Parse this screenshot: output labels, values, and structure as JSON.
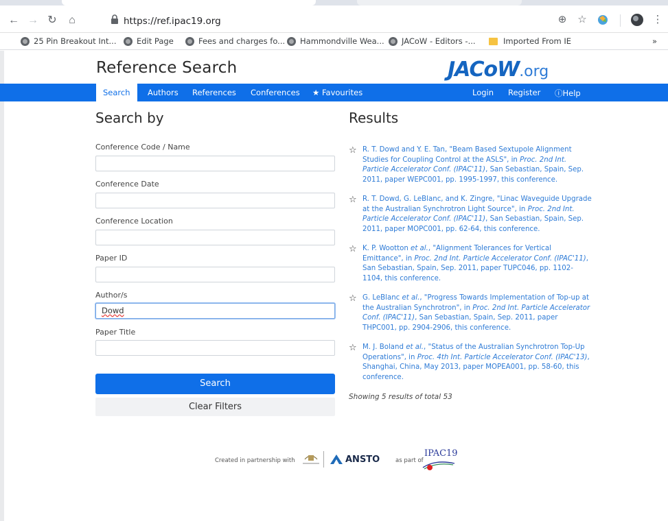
{
  "browser": {
    "url": "https://ref.ipac19.org",
    "bookmarks": [
      {
        "label": "25 Pin Breakout Int...",
        "icon": "globe-icon"
      },
      {
        "label": "Edit Page",
        "icon": "globe-icon"
      },
      {
        "label": "Fees and charges fo...",
        "icon": "globe-icon"
      },
      {
        "label": "Hammondville Wea...",
        "icon": "globe-icon"
      },
      {
        "label": "JACoW - Editors -...",
        "icon": "globe-icon"
      },
      {
        "label": "Imported From IE",
        "icon": "folder-icon"
      }
    ],
    "overflow": "»"
  },
  "header": {
    "title": "Reference Search",
    "logo_main": "JACoW",
    "logo_suffix": ".org"
  },
  "nav": {
    "items": [
      "Search",
      "Authors",
      "References",
      "Conferences",
      "Favourites"
    ],
    "right_items": [
      "Login",
      "Register",
      "Help"
    ],
    "active": "Search",
    "accent_color": "#0f6fe8"
  },
  "search_form": {
    "title": "Search by",
    "fields": [
      {
        "label": "Conference Code / Name",
        "value": ""
      },
      {
        "label": "Conference Date",
        "value": ""
      },
      {
        "label": "Conference Location",
        "value": ""
      },
      {
        "label": "Paper ID",
        "value": ""
      },
      {
        "label": "Author/s",
        "value": "Dowd"
      },
      {
        "label": "Paper Title",
        "value": ""
      }
    ],
    "search_label": "Search",
    "clear_label": "Clear Filters"
  },
  "results": {
    "title": "Results",
    "items": [
      {
        "before": "R. T. Dowd and Y. E. Tan, \"Beam Based Sextupole Alignment Studies for Coupling Control at the ASLS\", in ",
        "italic": "Proc. 2nd Int. Particle Accelerator Conf. (IPAC'11)",
        "after": ", San Sebastian, Spain, Sep. 2011, paper WEPC001, pp. 1995-1997, this conference."
      },
      {
        "before": "R. T. Dowd, G. LeBlanc, and K. Zingre, \"Linac Waveguide Upgrade at the Australian Synchrotron Light Source\", in ",
        "italic": "Proc. 2nd Int. Particle Accelerator Conf. (IPAC'11)",
        "after": ", San Sebastian, Spain, Sep. 2011, paper MOPC001, pp. 62-64, this conference."
      },
      {
        "before": "K. P. Wootton ",
        "italic0": "et al.",
        "middle": ", \"Alignment Tolerances for Vertical Emittance\", in ",
        "italic": "Proc. 2nd Int. Particle Accelerator Conf. (IPAC'11)",
        "after": ", San Sebastian, Spain, Sep. 2011, paper TUPC046, pp. 1102-1104, this conference."
      },
      {
        "before": "G. LeBlanc ",
        "italic0": "et al.",
        "middle": ", \"Progress Towards Implementation of Top-up at the Australian Synchrotron\", in ",
        "italic": "Proc. 2nd Int. Particle Accelerator Conf. (IPAC'11)",
        "after": ", San Sebastian, Spain, Sep. 2011, paper THPC001, pp. 2904-2906, this conference."
      },
      {
        "before": "M. J. Boland ",
        "italic0": "et al.",
        "middle": ", \"Status of the Australian Synchrotron Top-Up Operations\", in ",
        "italic": "Proc. 4th Int. Particle Accelerator Conf. (IPAC'13)",
        "after": ", Shanghai, China, May 2013, paper MOPEA001, pp. 58-60, this conference."
      }
    ],
    "showing": "Showing 5 results of total 53"
  },
  "footer": {
    "partner_text": "Created in partnership with",
    "partner_name": "ANSTO",
    "part_of_text": "as part of",
    "event_logo": "IPAC19"
  }
}
